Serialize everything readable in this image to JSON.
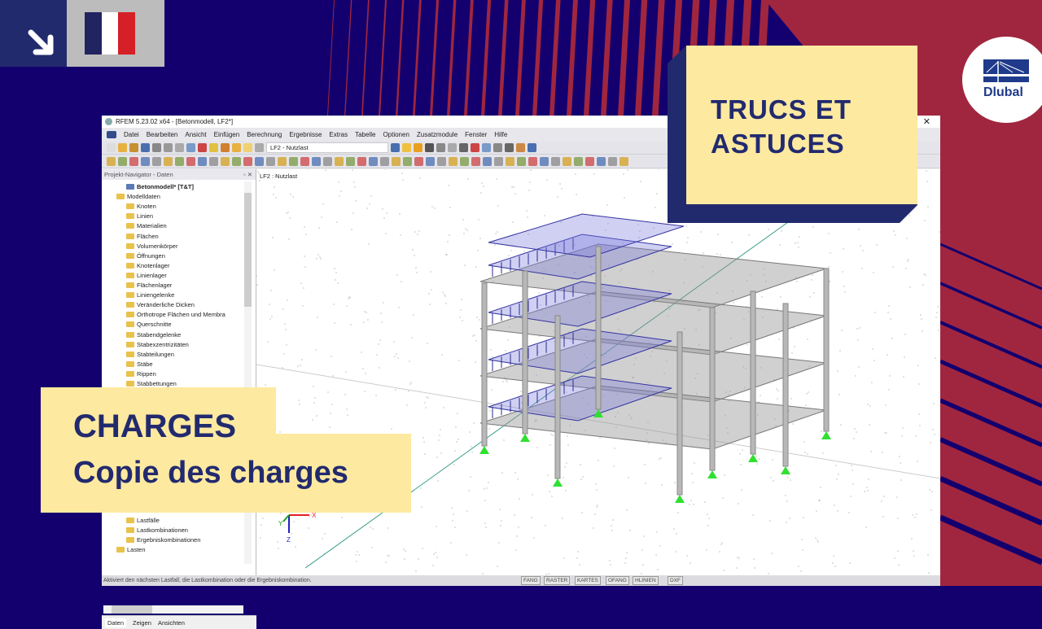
{
  "banner": {
    "title_line1": "TRUCS ET",
    "title_line2": "ASTUCES",
    "topic": "CHARGES",
    "subtitle": "Copie des charges",
    "logo_text": "Dlubal",
    "colors": {
      "background": "#13006e",
      "stripe": "#a0263f",
      "yellow": "#fde9a0",
      "navy": "#222a6e"
    }
  },
  "window": {
    "title": "RFEM 5.23.02 x64 - [Betonmodell, LF2*]",
    "menu": [
      "Datei",
      "Bearbeiten",
      "Ansicht",
      "Einfügen",
      "Berechnung",
      "Ergebnisse",
      "Extras",
      "Tabelle",
      "Optionen",
      "Zusatzmodule",
      "Fenster",
      "Hilfe"
    ],
    "loadcase_combo": "LF2 - Nutzlast",
    "navigator_title": "Projekt-Navigator - Daten",
    "tree": [
      {
        "label": "Betonmodell* [T&T]",
        "level": 0,
        "bold": true
      },
      {
        "label": "Modelldaten",
        "level": 1
      },
      {
        "label": "Knoten",
        "level": 2
      },
      {
        "label": "Linien",
        "level": 2
      },
      {
        "label": "Materialien",
        "level": 2
      },
      {
        "label": "Flächen",
        "level": 2
      },
      {
        "label": "Volumenkörper",
        "level": 2
      },
      {
        "label": "Öffnungen",
        "level": 2
      },
      {
        "label": "Knotenlager",
        "level": 2
      },
      {
        "label": "Linienlager",
        "level": 2
      },
      {
        "label": "Flächenlager",
        "level": 2
      },
      {
        "label": "Liniengelenke",
        "level": 2
      },
      {
        "label": "Veränderliche Dicken",
        "level": 2
      },
      {
        "label": "Orthotrope Flächen und Membra",
        "level": 2
      },
      {
        "label": "Querschnitte",
        "level": 2
      },
      {
        "label": "Stabendgelenke",
        "level": 2
      },
      {
        "label": "Stabexzentrizitäten",
        "level": 2
      },
      {
        "label": "Stabteilungen",
        "level": 2
      },
      {
        "label": "Stäbe",
        "level": 2
      },
      {
        "label": "Rippen",
        "level": 2
      },
      {
        "label": "Stabbettungen",
        "level": 2
      }
    ],
    "tree_bottom": [
      {
        "label": "Lastfälle"
      },
      {
        "label": "Lastkombinationen"
      },
      {
        "label": "Ergebniskombinationen"
      },
      {
        "label": "Lasten"
      }
    ],
    "nav_tabs": [
      "Daten",
      "Zeigen",
      "Ansichten"
    ],
    "view_label": "LF2 : Nutzlast",
    "axes": {
      "x": "X",
      "y": "Y",
      "z": "Z"
    },
    "status_text": "Aktiviert den nächsten Lastfall, die Lastkombination oder die Ergebniskombination.",
    "status_buttons": [
      "FANG",
      "RASTER",
      "KARTES",
      "OFANG",
      "HLINIEN",
      "DXF"
    ]
  }
}
